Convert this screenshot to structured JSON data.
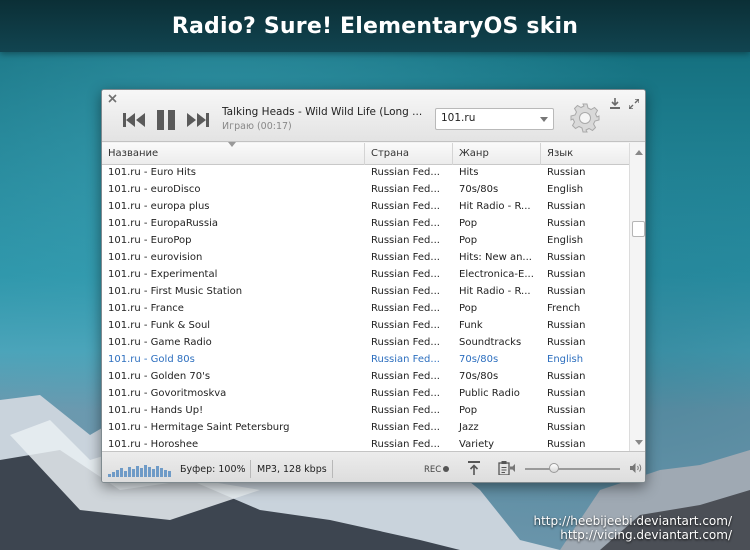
{
  "banner": {
    "title": "Radio? Sure! ElementaryOS skin"
  },
  "credits": {
    "line1": "http://heebijeebi.deviantart.com/",
    "line2": "http://vicing.deviantart.com/"
  },
  "player": {
    "track": "Talking Heads - Wild Wild Life (Long ...",
    "status": "Играю (00:17)",
    "station": "101.ru",
    "icons": [
      "close-icon",
      "previous-icon",
      "pause-icon",
      "next-icon",
      "download-icon",
      "expand-icon",
      "gear-icon"
    ]
  },
  "table": {
    "columns": [
      "Название",
      "Страна",
      "Жанр",
      "Язык"
    ],
    "rows": [
      [
        "101.ru - Euro Hits",
        "Russian Fed...",
        "Hits",
        "Russian"
      ],
      [
        "101.ru - euroDisco",
        "Russian Fed...",
        "70s/80s",
        "English"
      ],
      [
        "101.ru - europa plus",
        "Russian Fed...",
        "Hit Radio - R...",
        "Russian"
      ],
      [
        "101.ru - EuropaRussia",
        "Russian Fed...",
        "Pop",
        "Russian"
      ],
      [
        "101.ru - EuroPop",
        "Russian Fed...",
        "Pop",
        "English"
      ],
      [
        "101.ru - eurovision",
        "Russian Fed...",
        "Hits: New an...",
        "Russian"
      ],
      [
        "101.ru - Experimental",
        "Russian Fed...",
        "Electronica-E...",
        "Russian"
      ],
      [
        "101.ru - First Music Station",
        "Russian Fed...",
        "Hit Radio - R...",
        "Russian"
      ],
      [
        "101.ru - France",
        "Russian Fed...",
        "Pop",
        "French"
      ],
      [
        "101.ru - Funk & Soul",
        "Russian Fed...",
        "Funk",
        "Russian"
      ],
      [
        "101.ru - Game Radio",
        "Russian Fed...",
        "Soundtracks",
        "Russian"
      ],
      [
        "101.ru - Gold 80s",
        "Russian Fed...",
        "70s/80s",
        "English"
      ],
      [
        "101.ru - Golden 70's",
        "Russian Fed...",
        "70s/80s",
        "Russian"
      ],
      [
        "101.ru - Govoritmoskva",
        "Russian Fed...",
        "Public Radio",
        "Russian"
      ],
      [
        "101.ru - Hands Up!",
        "Russian Fed...",
        "Pop",
        "Russian"
      ],
      [
        "101.ru - Hermitage Saint Petersburg",
        "Russian Fed...",
        "Jazz",
        "Russian"
      ],
      [
        "101.ru - Horoshee",
        "Russian Fed...",
        "Variety",
        "Russian"
      ]
    ],
    "active_row": 11,
    "active_color": "#2d6fbf"
  },
  "statusbar": {
    "buffer": "Буфер: 100%",
    "format": "MP3, 128 kbps",
    "rec": "REC",
    "volume_fraction": 0.3,
    "icons": [
      "visualizer-icon",
      "record-icon",
      "upload-icon",
      "clipboard-icon",
      "volume-low-icon",
      "volume-high-icon"
    ]
  }
}
